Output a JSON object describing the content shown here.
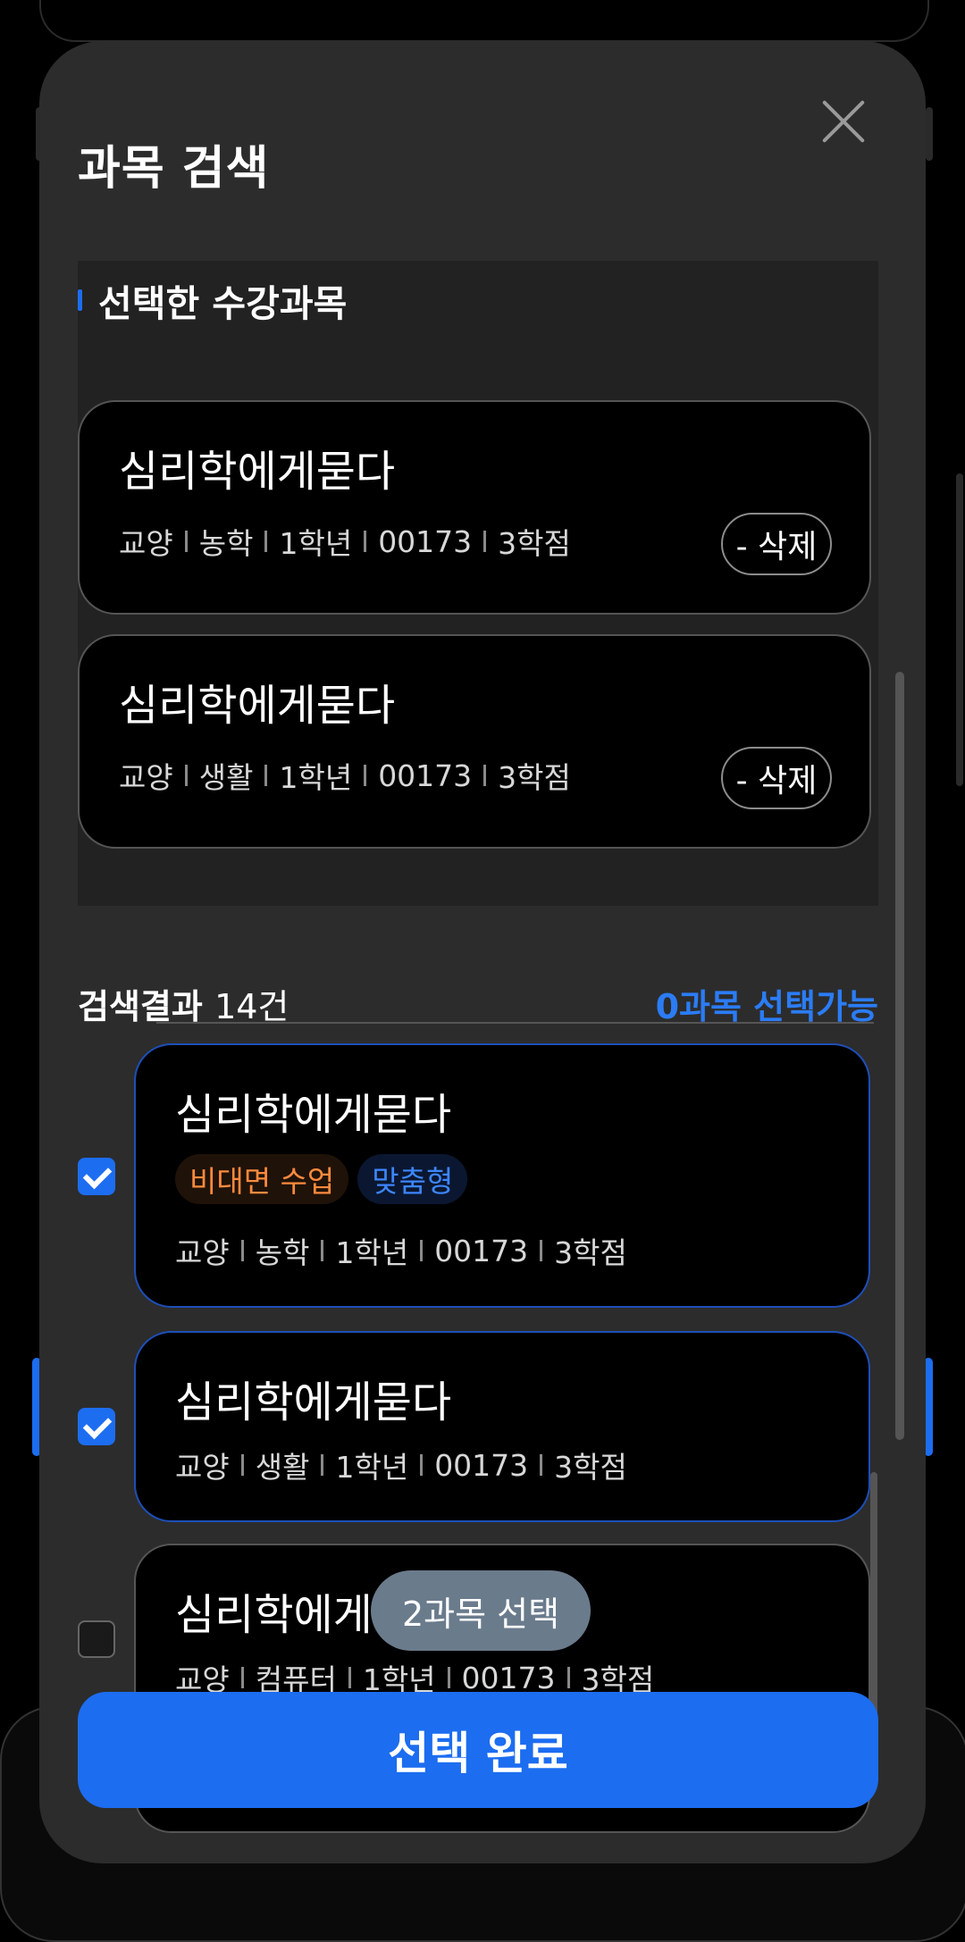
{
  "sheet": {
    "title": "과목 검색"
  },
  "selected": {
    "heading": "선택한 수강과목",
    "delete_label": "- 삭제",
    "items": [
      {
        "title": "심리학에게묻다",
        "meta": [
          "교양",
          "농학",
          "1학년",
          "00173",
          "3학점"
        ]
      },
      {
        "title": "심리학에게묻다",
        "meta": [
          "교양",
          "생활",
          "1학년",
          "00173",
          "3학점"
        ]
      }
    ]
  },
  "results": {
    "label": "검색결과",
    "count": "14건",
    "available": "0과목 선택가능",
    "items": [
      {
        "title": "심리학에게묻다",
        "tags": [
          "비대면 수업",
          "맞춤형"
        ],
        "meta": [
          "교양",
          "농학",
          "1학년",
          "00173",
          "3학점"
        ],
        "checked": true
      },
      {
        "title": "심리학에게묻다",
        "tags": [],
        "meta": [
          "교양",
          "생활",
          "1학년",
          "00173",
          "3학점"
        ],
        "checked": true
      },
      {
        "title": "심리학에게",
        "tags": [],
        "meta": [
          "교양",
          "컴퓨터",
          "1학년",
          "00173",
          "3학점"
        ],
        "checked": false
      }
    ]
  },
  "toast": "2과목 선택",
  "done_button": "선택 완료",
  "colors": {
    "accent": "#1c6df0",
    "tag_orange": "#ff8a3d",
    "tag_blue": "#3c86ff",
    "sheet_bg": "#2c2c2c"
  }
}
